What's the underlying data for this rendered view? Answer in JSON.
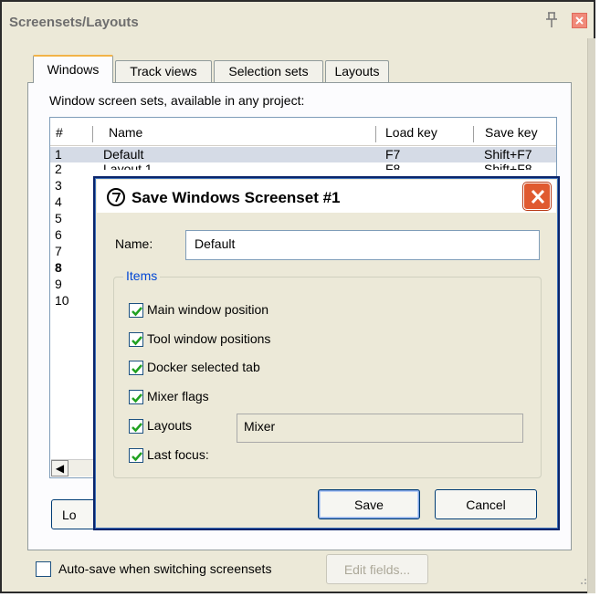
{
  "panel": {
    "title": "Screensets/Layouts",
    "tabs": [
      "Windows",
      "Track views",
      "Selection sets",
      "Layouts"
    ],
    "description": "Window screen sets, available in any project:"
  },
  "list": {
    "columns": [
      "#",
      "Name",
      "Load key",
      "Save key"
    ],
    "first_row": {
      "num": "1",
      "name": "Default",
      "load_key": "F7",
      "save_key": "Shift+F7"
    },
    "row_numbers": [
      "2",
      "3",
      "4",
      "5",
      "6",
      "7",
      "8",
      "9",
      "10"
    ],
    "partial_row_2": {
      "name": "Layout 1",
      "load_key": "F8",
      "save_key": "Shift+F8"
    }
  },
  "load_button": "Lo",
  "bottom": {
    "autosave_label": "Auto-save when switching screensets",
    "autosave_checked": false,
    "edit_fields_label": "Edit fields..."
  },
  "dialog": {
    "title": "Save Windows Screenset #1",
    "name_label": "Name:",
    "name_value": "Default",
    "items_legend": "Items",
    "items": [
      {
        "label": "Main window position",
        "checked": true
      },
      {
        "label": "Tool window positions",
        "checked": true
      },
      {
        "label": "Docker selected tab",
        "checked": true
      },
      {
        "label": "Mixer flags",
        "checked": true
      },
      {
        "label": "Layouts",
        "checked": true
      },
      {
        "label": "Last focus:",
        "checked": true
      }
    ],
    "last_focus_value": "Mixer",
    "save_label": "Save",
    "cancel_label": "Cancel"
  },
  "colors": {
    "tab_accent": "#f2b348",
    "legend": "#0046d5",
    "close_red": "#e05a30",
    "checkmark": "#21a121"
  }
}
